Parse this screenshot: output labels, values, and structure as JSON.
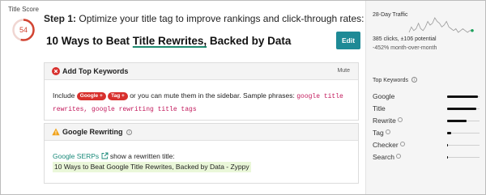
{
  "score": {
    "label": "Title Score",
    "value": "54",
    "fraction": 0.54,
    "color": "#d24533"
  },
  "step": {
    "prefix": "Step 1:",
    "text": "Optimize your title tag to improve rankings and click-through rates:"
  },
  "title": {
    "part1": "10 Ways to Beat ",
    "highlight": "Title Rewrites,",
    "part2": " Backed by Data"
  },
  "edit_label": "Edit",
  "keywords_card": {
    "title": "Add Top Keywords",
    "mute": "Mute",
    "text1": "Include ",
    "tag1": "Google +",
    "tag2": "Tag +",
    "text2": " or you can mute them in the sidebar. Sample phrases: ",
    "phrase1": "google title rewrites",
    "sep": ", ",
    "phrase2": "google rewriting title tags"
  },
  "rewriting_card": {
    "title": "Google Rewriting",
    "link": "Google SERPs",
    "text": " show a rewritten title:",
    "serp_title": "10 Ways to Beat Google Title Rewrites, Backed by Data - Zyppy"
  },
  "sidebar": {
    "traffic_label": "28-Day Traffic",
    "clicks": "385 clicks, ±106 potential",
    "change": "-452% month-over-month",
    "sparkline": [
      3,
      6,
      4,
      5,
      8,
      5,
      4,
      6,
      9,
      7,
      8,
      11,
      9,
      8,
      6,
      7,
      9,
      6,
      5,
      4,
      5,
      3,
      4,
      5,
      4,
      3,
      4,
      4
    ],
    "keywords_label": "Top Keywords",
    "keywords": [
      {
        "name": "Google",
        "strength": 0.95
      },
      {
        "name": "Title",
        "strength": 0.9
      },
      {
        "name": "Rewrite",
        "strength": 0.6
      },
      {
        "name": "Tag",
        "strength": 0.12
      },
      {
        "name": "Checker",
        "strength": 0.02
      },
      {
        "name": "Search",
        "strength": 0.02
      }
    ]
  },
  "colors": {
    "accent": "#1e8a96",
    "error": "#d8302d",
    "warning": "#f0a21a",
    "link": "#1a8a7a",
    "highlight": "#eaf7d9",
    "spark_dot": "#1aa05a"
  }
}
